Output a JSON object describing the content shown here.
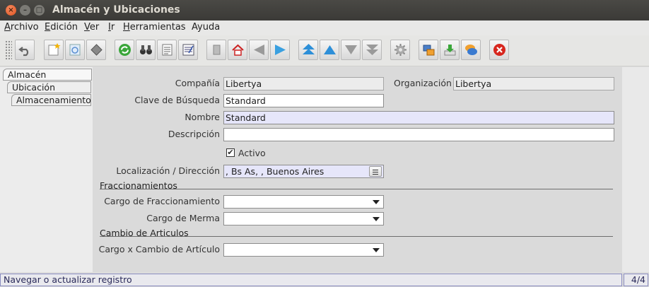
{
  "window": {
    "title": "Almacén y Ubicaciones"
  },
  "menubar": {
    "items": [
      {
        "first": "A",
        "rest": "rchivo"
      },
      {
        "first": "E",
        "rest": "dición"
      },
      {
        "first": "V",
        "rest": "er"
      },
      {
        "first": "I",
        "rest": "r"
      },
      {
        "first": "H",
        "rest": "erramientas"
      },
      {
        "first": "",
        "rest": "Ayuda"
      }
    ]
  },
  "left_tabs": [
    "Almacén",
    "Ubicación",
    "Almacenamiento"
  ],
  "form": {
    "company_label": "Compañía",
    "company_value": "Libertya",
    "org_label": "Organización",
    "org_value": "Libertya",
    "search_key_label": "Clave de Búsqueda",
    "search_key_value": "Standard",
    "name_label": "Nombre",
    "name_value": "Standard",
    "description_label": "Descripción",
    "description_value": "",
    "active_label": "Activo",
    "active_checked": "✔",
    "location_label": "Localización / Dirección",
    "location_value": ", Bs As,  , Buenos Aires",
    "section_fractioning": "Fraccionamientos",
    "fractioning_charge_label": "Cargo de Fraccionamiento",
    "fractioning_charge_value": "",
    "waste_charge_label": "Cargo de Merma",
    "waste_charge_value": "",
    "section_article_change": "Cambio de Articulos",
    "article_change_charge_label": "Cargo x Cambio de Artículo",
    "article_change_charge_value": ""
  },
  "status": {
    "message": "Navegar o actualizar registro",
    "record": "4/4"
  }
}
